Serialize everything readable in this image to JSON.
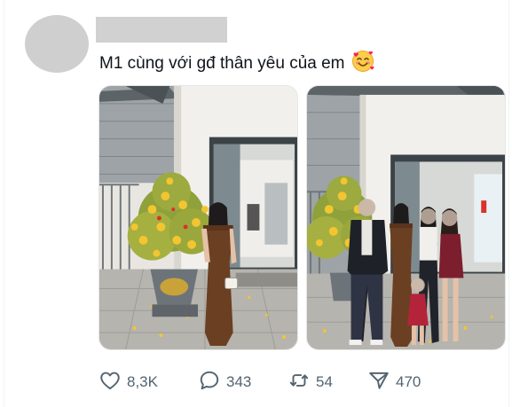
{
  "post": {
    "text": "M1 cùng với gđ thân yêu của em",
    "emoji": "smiling-face-with-hearts"
  },
  "media": [
    {
      "name": "photo-woman-brown-dress-with-flower-tree"
    },
    {
      "name": "photo-family-group-with-flower-tree"
    }
  ],
  "actions": {
    "like_count": "8,3K",
    "reply_count": "343",
    "retweet_count": "54",
    "share_count": "470"
  },
  "icons": {
    "like": "heart-icon",
    "reply": "speech-bubble-icon",
    "retweet": "retweet-arrows-icon",
    "share": "paper-plane-icon"
  },
  "colors": {
    "text": "#0f1419",
    "muted": "#536471",
    "dress": "#6b3f22",
    "flowers": "#f2c531"
  }
}
